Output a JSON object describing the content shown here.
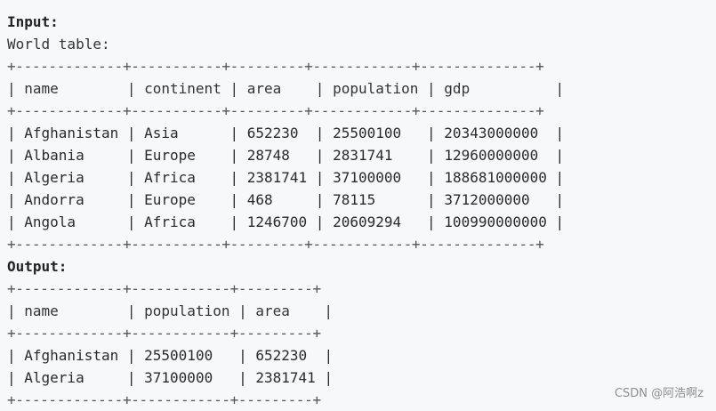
{
  "input": {
    "heading": "Input:",
    "caption": "World table:",
    "columns": [
      "name",
      "continent",
      "area",
      "population",
      "gdp"
    ],
    "rows": [
      [
        "Afghanistan",
        "Asia",
        "652230",
        "25500100",
        "20343000000"
      ],
      [
        "Albania",
        "Europe",
        "28748",
        "2831741",
        "12960000000"
      ],
      [
        "Algeria",
        "Africa",
        "2381741",
        "37100000",
        "188681000000"
      ],
      [
        "Andorra",
        "Europe",
        "468",
        "78115",
        "3712000000"
      ],
      [
        "Angola",
        "Africa",
        "1246700",
        "20609294",
        "100990000000"
      ]
    ]
  },
  "output": {
    "heading": "Output:",
    "columns": [
      "name",
      "population",
      "area"
    ],
    "rows": [
      [
        "Afghanistan",
        "25500100",
        "652230"
      ],
      [
        "Algeria",
        "37100000",
        "2381741"
      ]
    ]
  },
  "watermark": "CSDN @阿浩啊z"
}
